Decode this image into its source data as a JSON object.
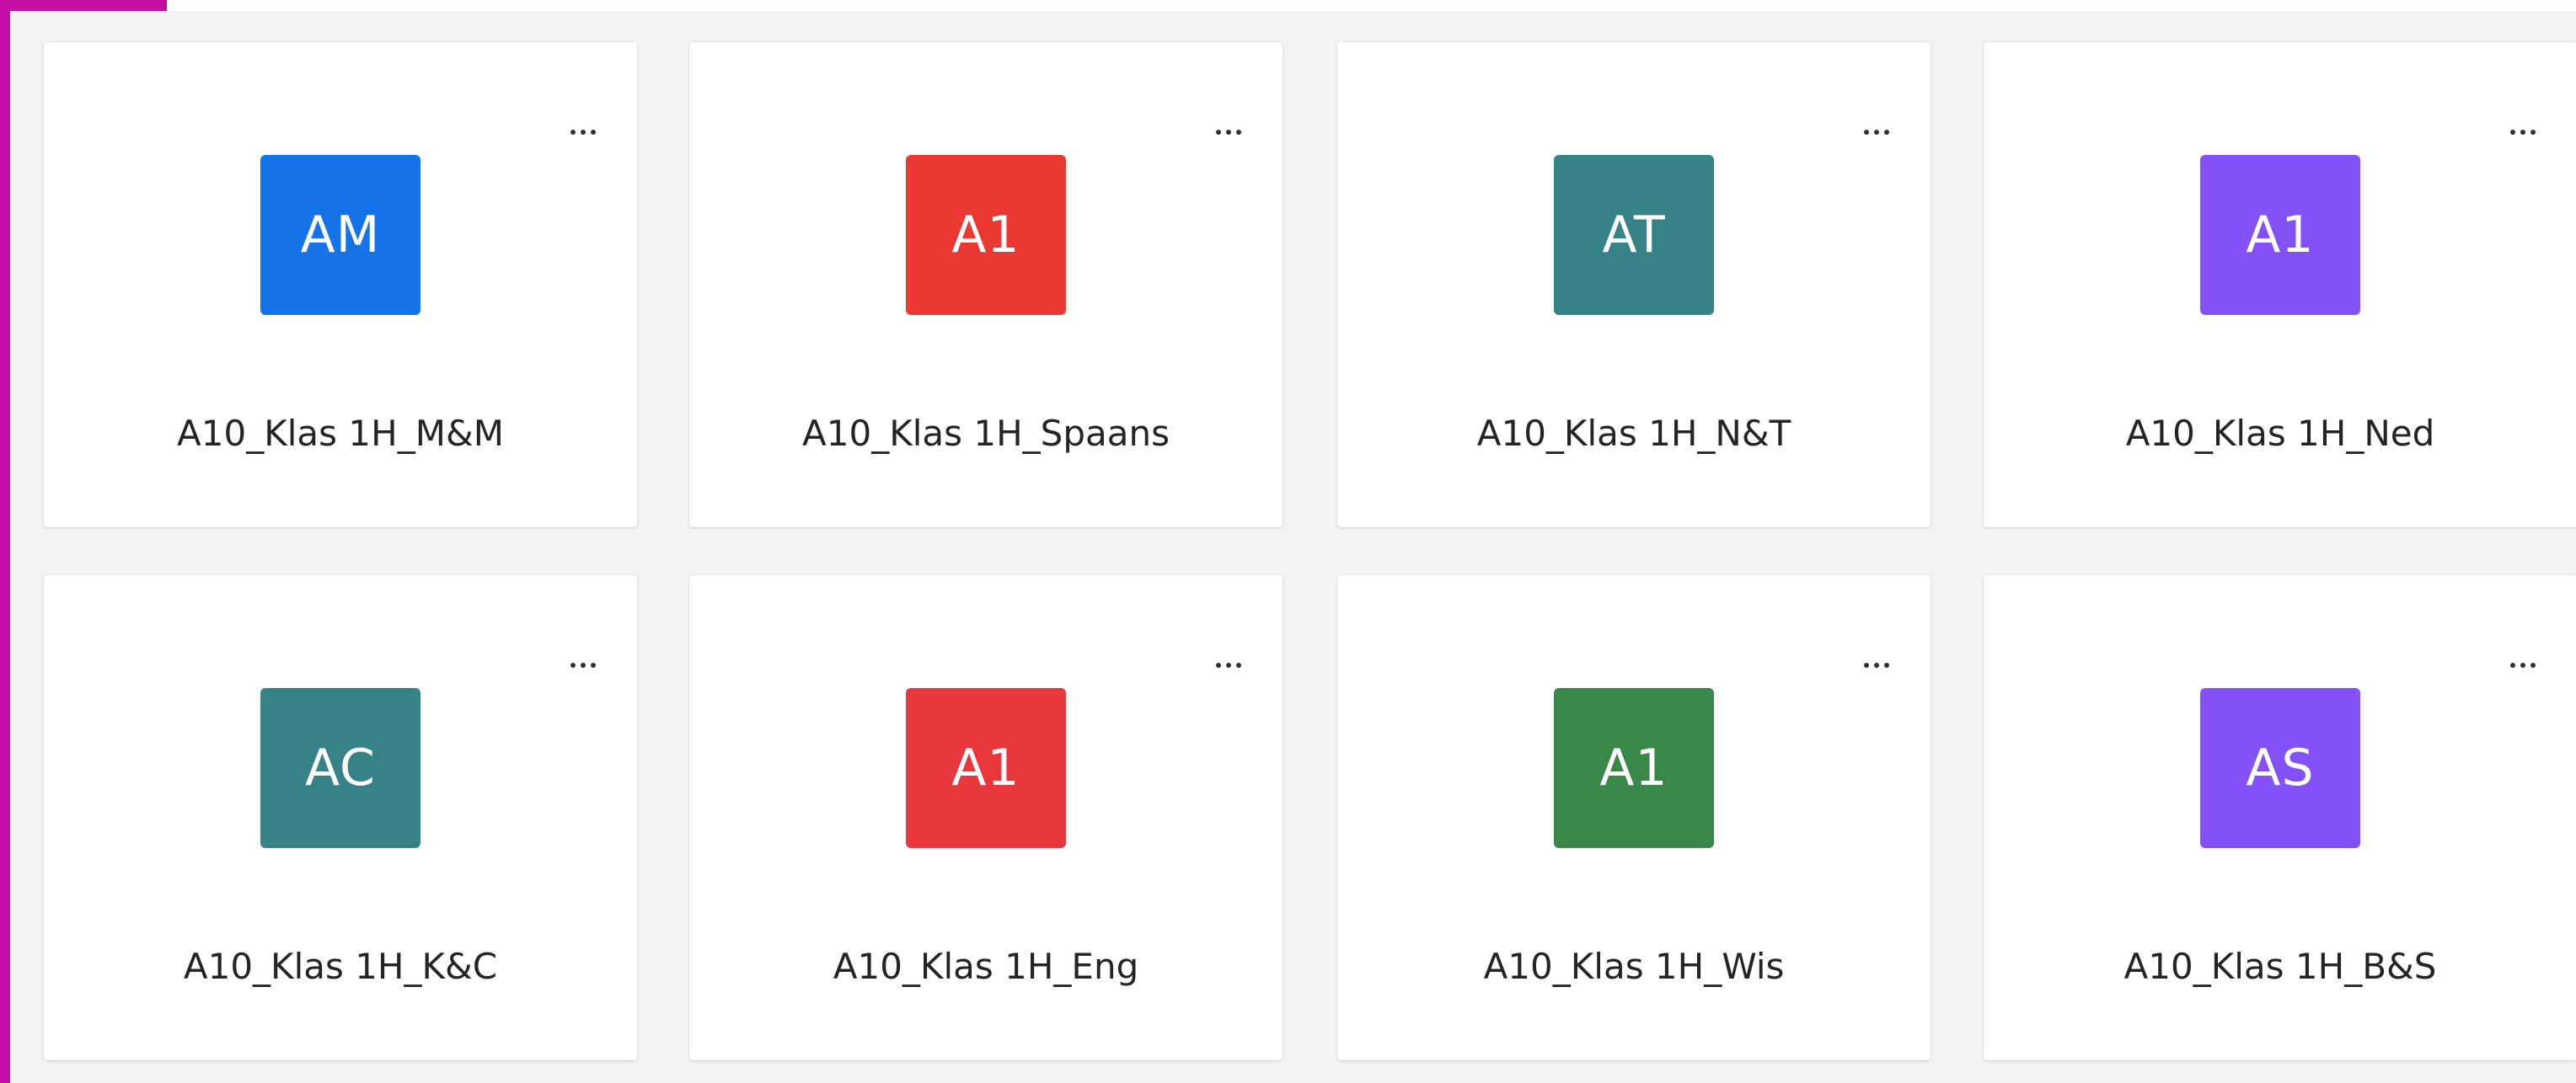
{
  "teams": [
    {
      "initials": "AM",
      "name": "A10_Klas 1H_M&M",
      "color": "#1573e8"
    },
    {
      "initials": "A1",
      "name": "A10_Klas 1H_Spaans",
      "color": "#ec3833"
    },
    {
      "initials": "AT",
      "name": "A10_Klas 1H_N&T",
      "color": "#368387"
    },
    {
      "initials": "A1",
      "name": "A10_Klas 1H_Ned",
      "color": "#8451f9"
    },
    {
      "initials": "AC",
      "name": "A10_Klas 1H_K&C",
      "color": "#368387"
    },
    {
      "initials": "A1",
      "name": "A10_Klas 1H_Eng",
      "color": "#e8383e"
    },
    {
      "initials": "A1",
      "name": "A10_Klas 1H_Wis",
      "color": "#3a874a"
    },
    {
      "initials": "AS",
      "name": "A10_Klas 1H_B&S",
      "color": "#8451f9"
    }
  ],
  "more_options_icon": "more-horizontal-icon"
}
